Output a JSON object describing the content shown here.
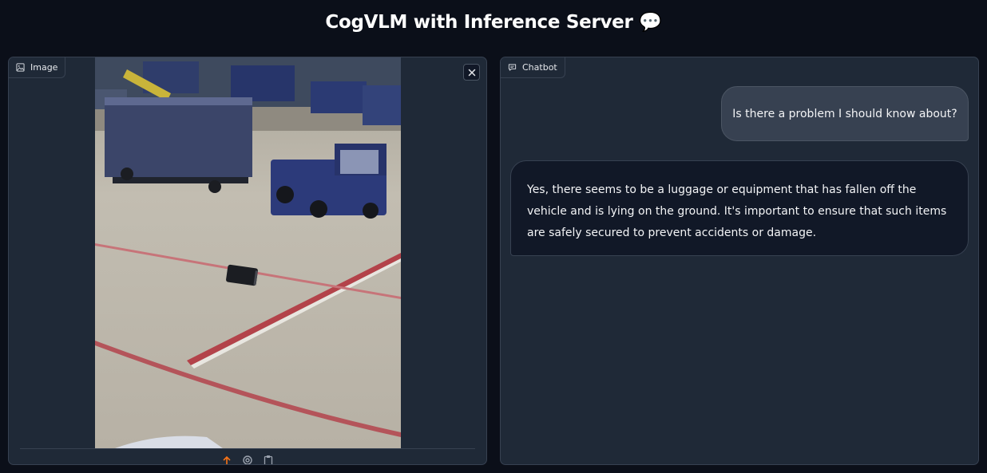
{
  "app": {
    "title": "CogVLM with Inference Server",
    "title_icon": "speech-bubble-icon"
  },
  "image_panel": {
    "label": "Image",
    "label_icon": "image-icon",
    "clear_icon": "close-icon",
    "toolbar_icons": [
      "upload-icon",
      "webcam-icon",
      "clipboard-icon"
    ],
    "accent": "#f97316"
  },
  "chat_panel": {
    "label": "Chatbot",
    "label_icon": "chat-icon",
    "messages": [
      {
        "role": "user",
        "text": "Is there a problem I should know about?"
      },
      {
        "role": "bot",
        "text": "Yes, there seems to be a luggage or equipment that has fallen off the vehicle and is lying on the ground. It's important to ensure that such items are safely secured to prevent accidents or damage."
      }
    ]
  }
}
